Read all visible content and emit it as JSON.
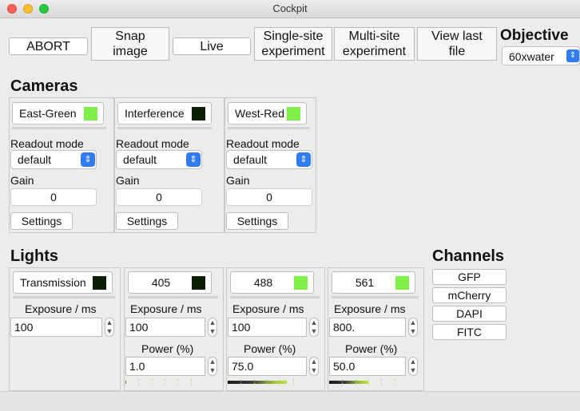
{
  "window": {
    "title": "Cockpit"
  },
  "toolbar": {
    "abort": "ABORT",
    "snap": "Snap\nimage",
    "live": "Live",
    "single_site": "Single-site\nexperiment",
    "multi_site": "Multi-site\nexperiment",
    "view_last": "View last\nfile",
    "objective_label": "Objective",
    "objective_value": "60xwater"
  },
  "cameras": {
    "title": "Cameras",
    "readout_label": "Readout mode",
    "gain_label": "Gain",
    "settings_label": "Settings",
    "items": [
      {
        "name": "East-Green",
        "color": "#7ff04a",
        "readout": "default",
        "gain": "0"
      },
      {
        "name": "Interference",
        "color": "#0b1f06",
        "readout": "default",
        "gain": "0"
      },
      {
        "name": "West-Red",
        "color": "#7ff04a",
        "readout": "default",
        "gain": "0"
      }
    ]
  },
  "lights": {
    "title": "Lights",
    "exposure_label": "Exposure / ms",
    "power_label": "Power (%)",
    "items": [
      {
        "name": "Transmission",
        "color": "#0b1f06",
        "exposure": "100"
      },
      {
        "name": "405",
        "color": "#0b1f06",
        "exposure": "100",
        "power": "1.0",
        "power_level": 1.0
      },
      {
        "name": "488",
        "color": "#7ff04a",
        "exposure": "100",
        "power": "75.0",
        "power_level": 75.0
      },
      {
        "name": "561",
        "color": "#7ff04a",
        "exposure": "800.",
        "power": "50.0",
        "power_level": 50.0
      }
    ]
  },
  "channels": {
    "title": "Channels",
    "items": [
      "GFP",
      "mCherry",
      "DAPI",
      "FITC"
    ]
  },
  "icons": {
    "stepper": "up-down-stepper-icon",
    "select_arrow": "up-down-chevron-icon"
  }
}
